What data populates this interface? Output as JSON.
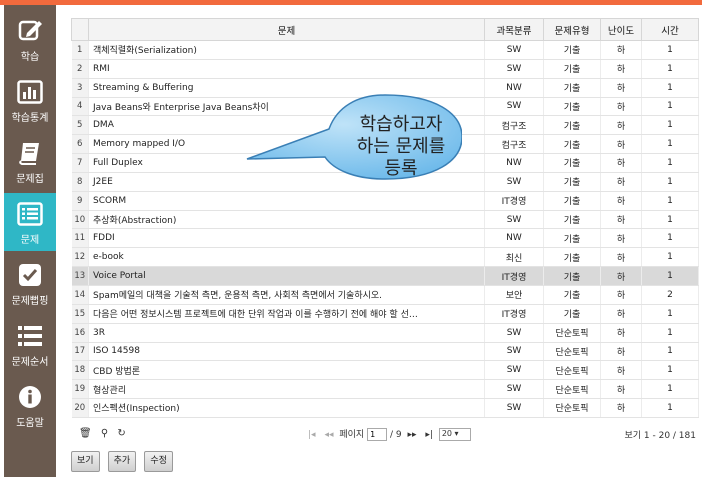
{
  "sidebar": {
    "items": [
      {
        "label": "학습",
        "icon": "edit-icon"
      },
      {
        "label": "학습통계",
        "icon": "bar-chart-icon"
      },
      {
        "label": "문제집",
        "icon": "book-icon"
      },
      {
        "label": "문제",
        "icon": "list-box-icon",
        "active": true
      },
      {
        "label": "문제뻡핑",
        "icon": "checkbox-icon"
      },
      {
        "label": "문제순서",
        "icon": "ordered-list-icon"
      },
      {
        "label": "도움말",
        "icon": "info-icon"
      }
    ]
  },
  "table": {
    "headers": [
      "",
      "문제",
      "과목분류",
      "문제유형",
      "난이도",
      "시간"
    ],
    "rows": [
      {
        "n": "1",
        "q": "객체직렬화(Serialization)",
        "cat": "SW",
        "type": "기출",
        "level": "하",
        "time": "1"
      },
      {
        "n": "2",
        "q": "RMI",
        "cat": "SW",
        "type": "기출",
        "level": "하",
        "time": "1"
      },
      {
        "n": "3",
        "q": "Streaming & Buffering",
        "cat": "NW",
        "type": "기출",
        "level": "하",
        "time": "1"
      },
      {
        "n": "4",
        "q": "Java Beans와 Enterprise Java Beans차이",
        "cat": "SW",
        "type": "기출",
        "level": "하",
        "time": "1"
      },
      {
        "n": "5",
        "q": "DMA",
        "cat": "컴구조",
        "type": "기출",
        "level": "하",
        "time": "1"
      },
      {
        "n": "6",
        "q": "Memory mapped I/O",
        "cat": "컴구조",
        "type": "기출",
        "level": "하",
        "time": "1"
      },
      {
        "n": "7",
        "q": "Full Duplex",
        "cat": "NW",
        "type": "기출",
        "level": "하",
        "time": "1"
      },
      {
        "n": "8",
        "q": "J2EE",
        "cat": "SW",
        "type": "기출",
        "level": "하",
        "time": "1"
      },
      {
        "n": "9",
        "q": "SCORM",
        "cat": "IT경영",
        "type": "기출",
        "level": "하",
        "time": "1"
      },
      {
        "n": "10",
        "q": "추상화(Abstraction)",
        "cat": "SW",
        "type": "기출",
        "level": "하",
        "time": "1"
      },
      {
        "n": "11",
        "q": "FDDI",
        "cat": "NW",
        "type": "기출",
        "level": "하",
        "time": "1"
      },
      {
        "n": "12",
        "q": "e-book",
        "cat": "최신",
        "type": "기출",
        "level": "하",
        "time": "1"
      },
      {
        "n": "13",
        "q": "Voice Portal",
        "cat": "IT경영",
        "type": "기출",
        "level": "하",
        "time": "1",
        "selected": true
      },
      {
        "n": "14",
        "q": "Spam메일의 대책을 기술적 측면, 운용적 측면, 사회적 측면에서 기술하시오.",
        "cat": "보안",
        "type": "기출",
        "level": "하",
        "time": "2"
      },
      {
        "n": "15",
        "q": "다음은 어떤 정보시스템 프로젝트에 대한 단위 작업과 이를 수행하기 전에 해야 할 선…",
        "cat": "IT경영",
        "type": "기출",
        "level": "하",
        "time": "1"
      },
      {
        "n": "16",
        "q": "3R",
        "cat": "SW",
        "type": "단순토픽",
        "level": "하",
        "time": "1"
      },
      {
        "n": "17",
        "q": "ISO 14598",
        "cat": "SW",
        "type": "단순토픽",
        "level": "하",
        "time": "1"
      },
      {
        "n": "18",
        "q": "CBD 방법론",
        "cat": "SW",
        "type": "단순토픽",
        "level": "하",
        "time": "1"
      },
      {
        "n": "19",
        "q": "형상관리",
        "cat": "SW",
        "type": "단순토픽",
        "level": "하",
        "time": "1"
      },
      {
        "n": "20",
        "q": "인스펙션(Inspection)",
        "cat": "SW",
        "type": "단순토픽",
        "level": "하",
        "time": "1"
      }
    ]
  },
  "callout": {
    "line1": "학습하고자",
    "line2": "하는 문제를",
    "line3": "등록"
  },
  "pager": {
    "page_label": "페이지",
    "page_value": "1",
    "page_total": "/ 9",
    "rows_per_page": "20",
    "summary": "보기 1 - 20 / 181"
  },
  "buttons": {
    "view": "보기",
    "add": "추가",
    "edit": "수정"
  },
  "colors": {
    "accent_top": "#f26a3d",
    "sidebar_bg": "#6a5a4f",
    "sidebar_active": "#2fb7c6",
    "callout_fill": "#8ccbf0"
  }
}
